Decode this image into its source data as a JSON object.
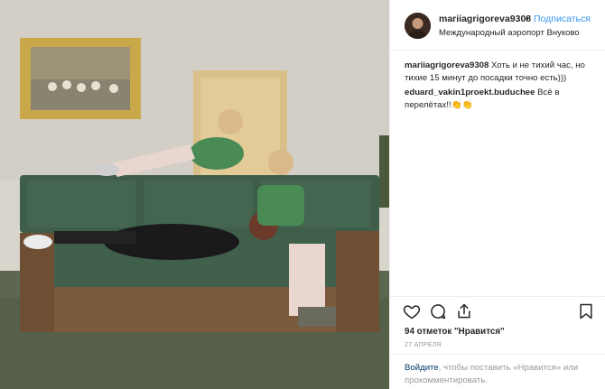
{
  "post": {
    "username": "mariiagrigoreva9308",
    "separator": "•",
    "follow_label": "Подписаться",
    "location": "Международный аэропорт Внуково"
  },
  "comments": [
    {
      "user": "mariiagrigoreva9308",
      "text": " Хоть и не тихий час, но тихие 15 минут до посадки точно есть)))"
    },
    {
      "user": "eduard_vakin1proekt.buduchee",
      "text": " Всё в перелётах!!👏👏"
    }
  ],
  "actions": {
    "like_icon": "heart-icon",
    "comment_icon": "comment-icon",
    "share_icon": "share-icon",
    "save_icon": "bookmark-icon"
  },
  "likes": "94 отметок \"Нравится\"",
  "date": "27 АПРЕЛЯ",
  "login_prompt": {
    "link": "Войдите",
    "text": ", чтобы поставить «Нравится» или прокомментировать."
  },
  "colors": {
    "follow": "#3897f0",
    "muted": "#999999",
    "link": "#003569",
    "border": "#efefef",
    "sofa": "#3e5e4a"
  }
}
